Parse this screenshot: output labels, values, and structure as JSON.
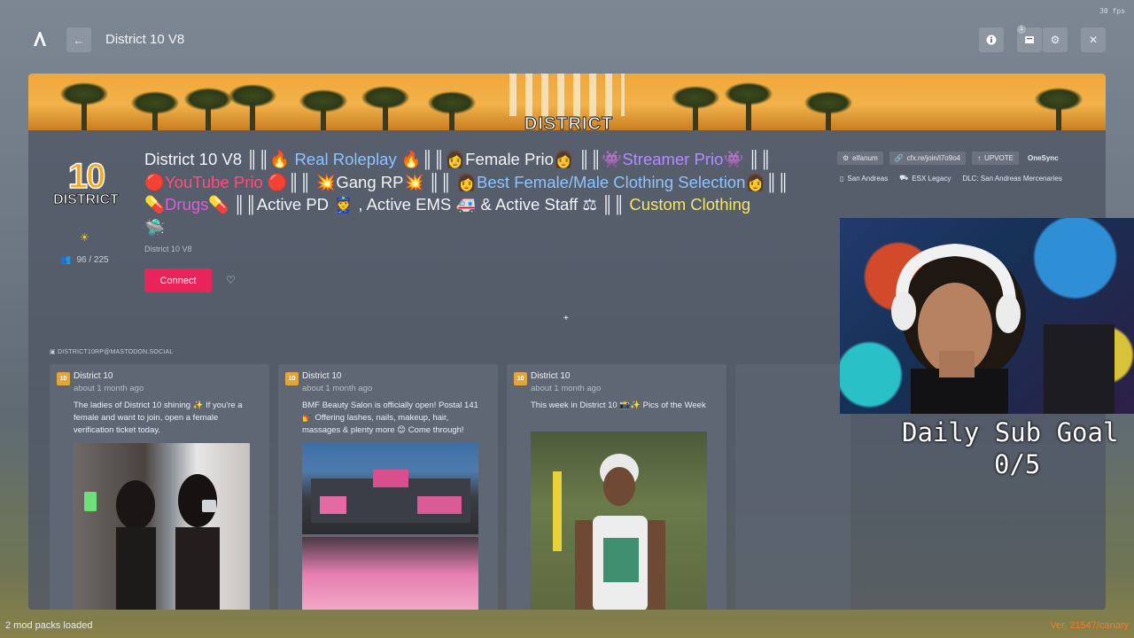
{
  "fps": "30 fps",
  "topbar": {
    "title": "District 10 V8",
    "notification_count": "1"
  },
  "server": {
    "logo_number": "10",
    "logo_text": "DISTRICT",
    "players": "96 / 225",
    "subtitle": "District 10 V8",
    "connect_label": "Connect",
    "description": {
      "l1_a": "District 10 V8 ║║🔥 ",
      "l1_b": "Real Roleplay",
      "l1_c": " 🔥║║👩Female Prio👩 ║║👾",
      "l1_d": "Streamer Prio",
      "l1_e": "👾 ║║",
      "l2_a": "🔴",
      "l2_b": "YouTube Prio",
      "l2_c": " 🔴║║ 💥Gang RP💥 ║║ 👩",
      "l2_d": "Best Female/Male Clothing Selection",
      "l2_e": "👩║║",
      "l3_a": "💊",
      "l3_b": "Drugs",
      "l3_c": "💊 ║║Active PD 👮 , Active EMS 🚑 & Active Staff ⚖ ║║ ",
      "l3_d": "Custom Clothing",
      "l4": "🛸"
    }
  },
  "tags": [
    {
      "icon": "⚙",
      "text": "elfanum"
    },
    {
      "icon": "🔗",
      "text": "cfx.re/join/l7o9o4"
    },
    {
      "icon": "↑",
      "text": "UPVOTE"
    },
    {
      "icon": "",
      "text": "OneSync"
    },
    {
      "icon": "▯",
      "text": "San Andreas"
    },
    {
      "icon": "⛟",
      "text": "ESX Legacy"
    },
    {
      "icon": "",
      "text": "DLC: San Andreas Mercenaries"
    }
  ],
  "feed": {
    "label": "DISTRICT10RP@MASTODON.SOCIAL",
    "posts": [
      {
        "name": "District 10",
        "time": "about 1 month ago",
        "text": "The ladies of District 10 shining ✨ If you're a female and want to join, open a female verification ticket today."
      },
      {
        "name": "District 10",
        "time": "about 1 month ago",
        "text": "BMF Beauty Salon is officially open! Postal 141 💅 Offering lashes, nails, makeup, hair, massages & plenty more 😊 Come through!"
      },
      {
        "name": "District 10",
        "time": "about 1 month ago",
        "text": "This week in District 10 📸✨ Pics of the Week"
      }
    ]
  },
  "stream_overlay": {
    "goal_title": "Daily Sub Goal",
    "goal_value": "0/5"
  },
  "status_bar": {
    "left": "2 mod packs loaded",
    "right": "Ver. 21547/canary"
  }
}
